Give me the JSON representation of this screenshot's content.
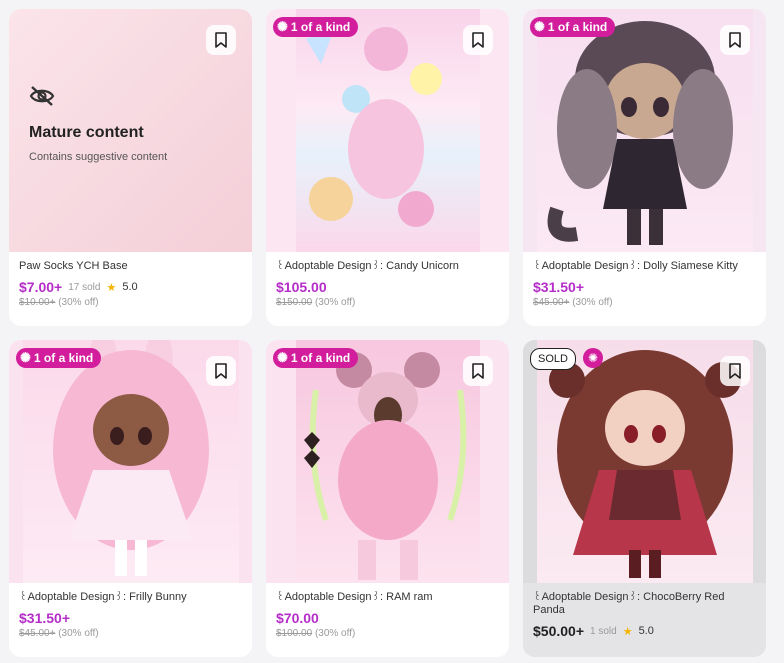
{
  "cards": [
    {
      "mature_title": "Mature content",
      "mature_subtitle": "Contains suggestive content",
      "title": "Paw Socks YCH Base",
      "price": "$7.00+",
      "sold": "17 sold",
      "rating": "5.0",
      "original_price": "$10.00+",
      "discount": "(30% off)"
    },
    {
      "badge": "1 of a kind",
      "title": "꒰Adoptable Design꒱: Candy Unicorn",
      "price": "$105.00",
      "original_price": "$150.00",
      "discount": "(30% off)"
    },
    {
      "badge": "1 of a kind",
      "title": "꒰Adoptable Design꒱: Dolly Siamese Kitty",
      "price": "$31.50+",
      "original_price": "$45.00+",
      "discount": "(30% off)"
    },
    {
      "badge": "1 of a kind",
      "title": "꒰Adoptable Design꒱: Frilly Bunny",
      "price": "$31.50+",
      "original_price": "$45.00+",
      "discount": "(30% off)"
    },
    {
      "badge": "1 of a kind",
      "title": "꒰Adoptable Design꒱: RAM ram",
      "price": "$70.00",
      "original_price": "$100.00",
      "discount": "(30% off)"
    },
    {
      "sold_badge": "SOLD",
      "title": "꒰Adoptable Design꒱: ChocoBerry Red Panda",
      "price": "$50.00+",
      "sold": "1 sold",
      "rating": "5.0"
    }
  ],
  "icons": {
    "bookmark": "bookmark-icon",
    "sparkle": "sparkle-icon",
    "star": "star-icon",
    "eye_slash": "eye-slash-icon"
  },
  "colors": {
    "price": "#b52dc8",
    "badge": "#d21e9c",
    "star": "#f5b400"
  }
}
